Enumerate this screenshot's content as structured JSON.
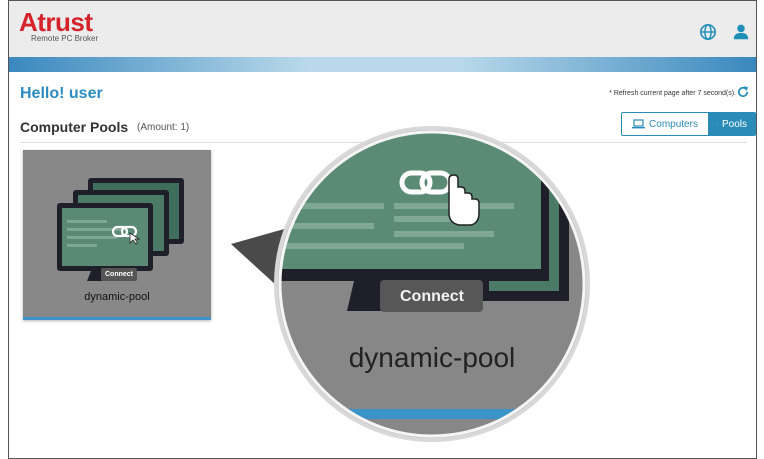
{
  "brand": {
    "name": "Atrust",
    "subtitle": "Remote PC Broker"
  },
  "header": {
    "language_icon": "globe-icon",
    "user_icon": "user-icon"
  },
  "greeting": "Hello!  user",
  "refresh_note": "* Refresh current page after 7 second(s).",
  "section": {
    "title": "Computer Pools",
    "amount": "(Amount: 1)"
  },
  "view_toggle": {
    "computers": "Computers",
    "pools": "Pools",
    "active": "Pools"
  },
  "pools": [
    {
      "name": "dynamic-pool",
      "connect_label": "Connect"
    }
  ],
  "zoom": {
    "connect_label": "Connect",
    "name": "dynamic-pool"
  },
  "colors": {
    "brand_red": "#d4232b",
    "accent_blue": "#2a8ab8",
    "card_gray": "#888888"
  }
}
